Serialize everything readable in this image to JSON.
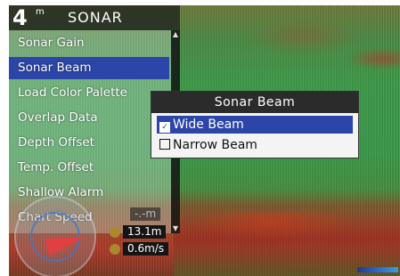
{
  "header": {
    "icon_glyph": "4",
    "unit": "m",
    "title": "SONAR"
  },
  "menu": {
    "items": [
      {
        "label": "Sonar Gain",
        "selected": false
      },
      {
        "label": "Sonar Beam",
        "selected": true
      },
      {
        "label": "Load Color Palette",
        "selected": false
      },
      {
        "label": "Overlap Data",
        "selected": false
      },
      {
        "label": "Depth Offset",
        "selected": false
      },
      {
        "label": "Temp. Offset",
        "selected": false
      },
      {
        "label": "Shallow Alarm",
        "selected": false
      },
      {
        "label": "Chart Speed",
        "selected": false
      }
    ],
    "scroll_up_glyph": "▲",
    "scroll_down_glyph": "▼"
  },
  "popup": {
    "title": "Sonar Beam",
    "options": [
      {
        "label": "Wide Beam",
        "checked": true,
        "check_glyph": "✓"
      },
      {
        "label": "Narrow Beam",
        "checked": false,
        "check_glyph": ""
      }
    ]
  },
  "readouts": {
    "depth_placeholder": "-.-m",
    "depth": "13.1m",
    "speed": "0.6m/s"
  },
  "colors": {
    "selection": "#2c45a8",
    "popup_title_bg": "#2b2b2b",
    "dial_needle": "#e04040"
  }
}
